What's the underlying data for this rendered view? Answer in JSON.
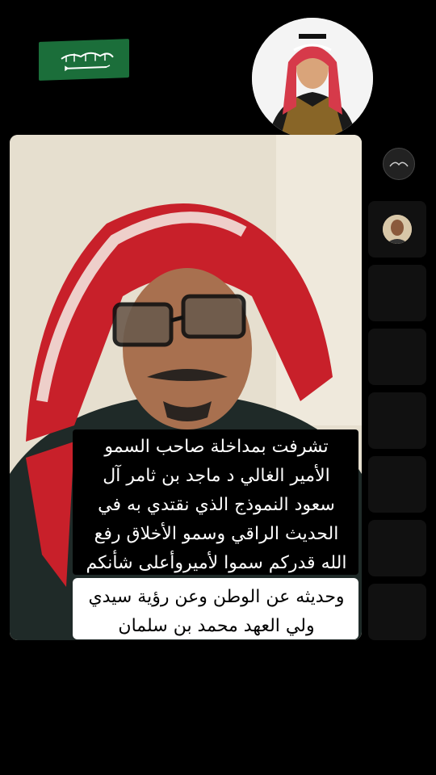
{
  "caption": {
    "dark_lines": [
      "تشرفت بمداخلة صاحب السمو",
      "الأمير الغالي د ماجد بن ثامر آل",
      "سعود النموذج الذي نقتدي به في",
      "الحديث الراقي وسمو الأخلاق رفع",
      "الله قدركم سموا لأميروأعلى شأنكم"
    ],
    "light_lines": [
      "وحديثه عن الوطن وعن رؤية سيدي",
      "ولي العهد محمد بن سلمان"
    ]
  },
  "colors": {
    "flag_green": "#1b6e3a",
    "shemagh_red": "#c8202a",
    "background": "#000000"
  },
  "icons": {
    "flag": "saudi-flag-icon",
    "logo": "channel-logo-icon"
  }
}
